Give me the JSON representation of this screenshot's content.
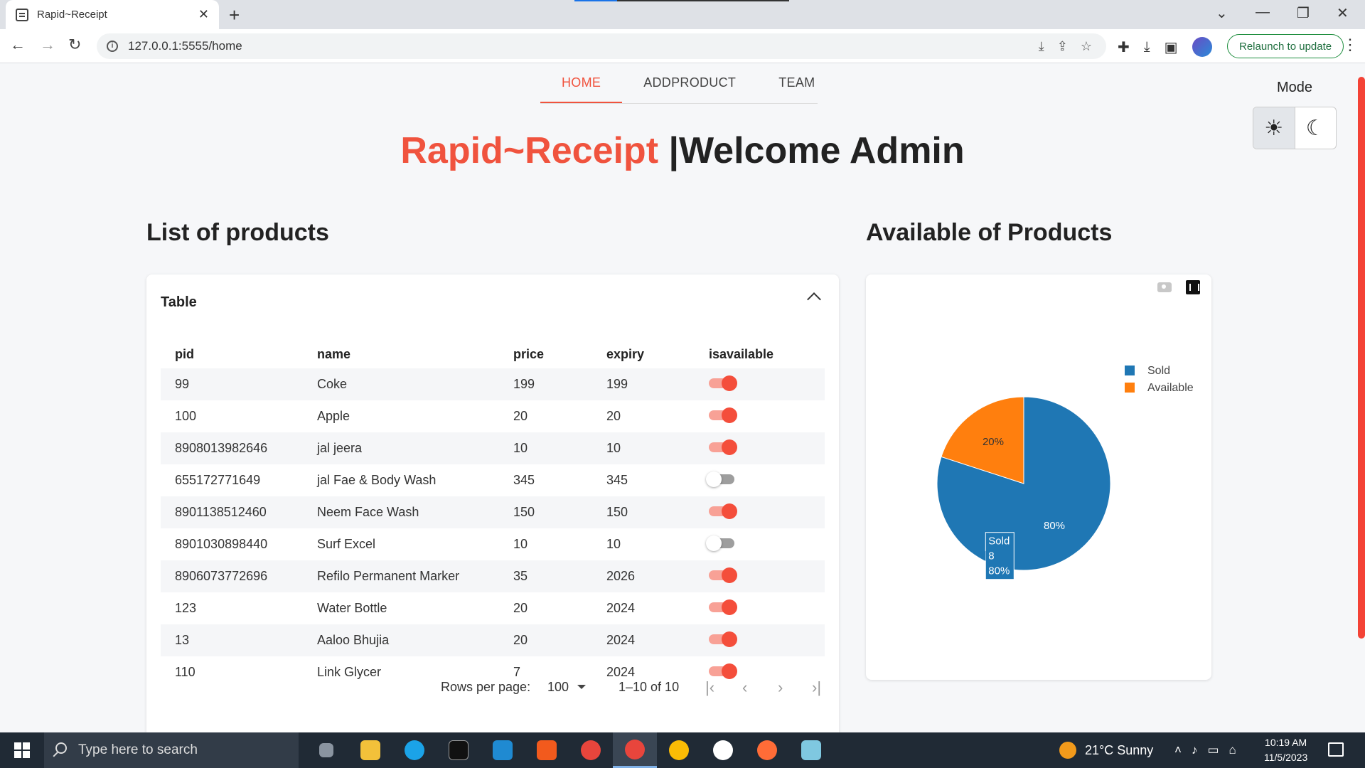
{
  "browser": {
    "tab_title": "Rapid~Receipt",
    "tab_close": "✕",
    "new_tab": "+",
    "url": "127.0.0.1:5555/home",
    "relaunch": "Relaunch to update"
  },
  "nav": {
    "home": "HOME",
    "addproduct": "ADDPRODUCT",
    "team": "TEAM"
  },
  "mode": {
    "label": "Mode",
    "light_icon": "sun-icon",
    "dark_icon": "moon-icon"
  },
  "hero": {
    "brand": "Rapid~Receipt",
    "welcome": " |Welcome Admin"
  },
  "products": {
    "title": "List of products",
    "card_title": "Table",
    "columns": [
      "pid",
      "name",
      "price",
      "expiry",
      "isavailable"
    ],
    "rows": [
      {
        "pid": "99",
        "name": "Coke",
        "price": "199",
        "expiry": "199",
        "isavailable": true
      },
      {
        "pid": "100",
        "name": "Apple",
        "price": "20",
        "expiry": "20",
        "isavailable": true
      },
      {
        "pid": "8908013982646",
        "name": "jal jeera",
        "price": "10",
        "expiry": "10",
        "isavailable": true
      },
      {
        "pid": "655172771649",
        "name": "jal Fae & Body Wash",
        "price": "345",
        "expiry": "345",
        "isavailable": false
      },
      {
        "pid": "8901138512460",
        "name": "Neem Face Wash",
        "price": "150",
        "expiry": "150",
        "isavailable": true
      },
      {
        "pid": "8901030898440",
        "name": "Surf Excel",
        "price": "10",
        "expiry": "10",
        "isavailable": false
      },
      {
        "pid": "8906073772696",
        "name": "Refilo Permanent Marker",
        "price": "35",
        "expiry": "2026",
        "isavailable": true
      },
      {
        "pid": "123",
        "name": "Water Bottle",
        "price": "20",
        "expiry": "2024",
        "isavailable": true
      },
      {
        "pid": "13",
        "name": "Aaloo Bhujia",
        "price": "20",
        "expiry": "2024",
        "isavailable": true
      },
      {
        "pid": "110",
        "name": "Link Glycer",
        "price": "7",
        "expiry": "2024",
        "isavailable": true
      }
    ],
    "pagination": {
      "rows_per_page_label": "Rows per page:",
      "rows_per_page": "100",
      "range": "1–10 of 10"
    }
  },
  "availability": {
    "title": "Available of Products"
  },
  "chart_data": {
    "type": "pie",
    "categories": [
      "Sold",
      "Available"
    ],
    "values": [
      80,
      20
    ],
    "labels": [
      "80%",
      "20%"
    ],
    "colors": [
      "#1f77b4",
      "#ff7f0e"
    ],
    "legend": [
      "Sold",
      "Available"
    ],
    "legend_position": "top-right",
    "hover": {
      "label": "Sold",
      "count": "8",
      "percent": "80%"
    }
  },
  "taskbar": {
    "search_placeholder": "Type here to search",
    "weather": "21°C  Sunny",
    "time": "10:19 AM",
    "date": "11/5/2023"
  },
  "colors": {
    "accent": "#f0533e",
    "toggle_on": "#f44e3b",
    "chrome_bg": "#dee1e6",
    "taskbar": "#202a35"
  }
}
